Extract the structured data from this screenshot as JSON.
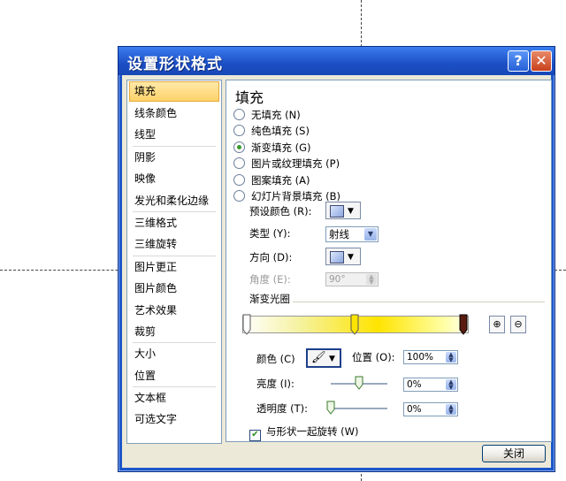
{
  "dialog": {
    "title": "设置形状格式",
    "help_label": "?",
    "close_label": "✕",
    "close_button": "关闭"
  },
  "nav": {
    "items": [
      {
        "label": "填充",
        "selected": true
      },
      {
        "label": "线条颜色"
      },
      {
        "label": "线型"
      },
      {
        "label": "阴影"
      },
      {
        "label": "映像"
      },
      {
        "label": "发光和柔化边缘"
      },
      {
        "label": "三维格式"
      },
      {
        "label": "三维旋转"
      },
      {
        "label": "图片更正"
      },
      {
        "label": "图片颜色"
      },
      {
        "label": "艺术效果"
      },
      {
        "label": "裁剪"
      },
      {
        "label": "大小"
      },
      {
        "label": "位置"
      },
      {
        "label": "文本框"
      },
      {
        "label": "可选文字"
      }
    ]
  },
  "fill": {
    "heading": "填充",
    "options": [
      {
        "label": "无填充 (N)",
        "checked": false
      },
      {
        "label": "纯色填充 (S)",
        "checked": false
      },
      {
        "label": "渐变填充 (G)",
        "checked": true
      },
      {
        "label": "图片或纹理填充 (P)",
        "checked": false
      },
      {
        "label": "图案填充 (A)",
        "checked": false
      },
      {
        "label": "幻灯片背景填充 (B)",
        "checked": false
      }
    ],
    "preset_label": "预设颜色 (R):",
    "type_label": "类型 (Y):",
    "type_value": "射线",
    "direction_label": "方向 (D):",
    "angle_label": "角度 (E):",
    "angle_value": "90°",
    "stops_label": "渐变光圈",
    "stop_positions": [
      0.02,
      0.5,
      1.0
    ],
    "color_label": "颜色 (C)",
    "position_label": "位置 (O):",
    "position_value": "100%",
    "brightness_label": "亮度 (I):",
    "brightness_value": "0%",
    "brightness_level": 0.5,
    "transparency_label": "透明度 (T):",
    "transparency_value": "0%",
    "transparency_level": 0.0,
    "rotate_label": "与形状一起旋转 (W)",
    "rotate_checked": true,
    "colors": {
      "stop_fill": "#ffe400",
      "selected_stop": "#5a1a10",
      "accent_green": "#3a9a2e"
    }
  }
}
